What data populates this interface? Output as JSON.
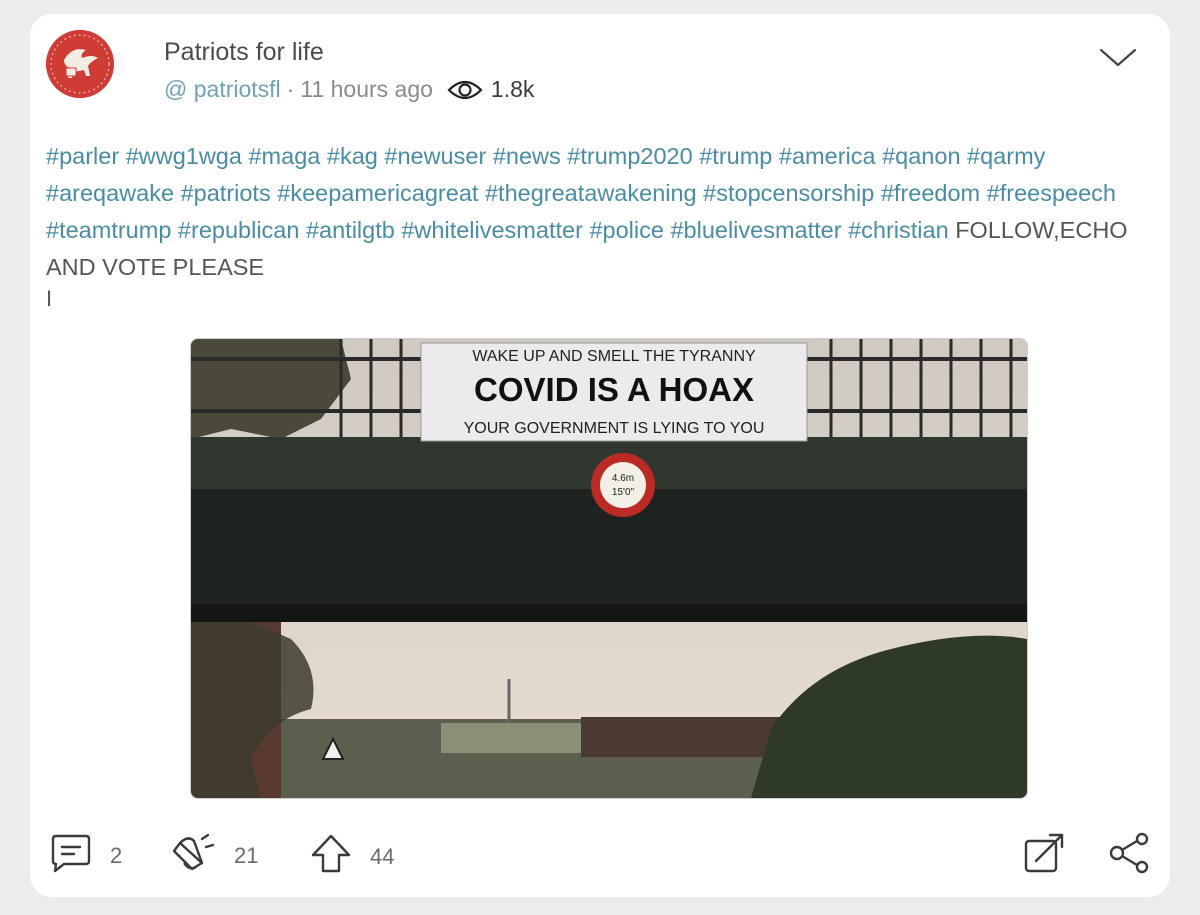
{
  "post": {
    "author": {
      "name": "Patriots for life",
      "handle": "@ patriotsfl",
      "time": "11 hours ago",
      "views": "1.8k",
      "avatar_icon": "winged-lion-icon"
    },
    "hashtags": [
      "#parler",
      "#wwg1wga",
      "#maga",
      "#kag",
      "#newuser",
      "#news",
      "#trump2020",
      "#trump",
      "#america",
      "#qanon",
      "#qarmy",
      "#areqawake",
      "#patriots",
      "#keepamericagreat",
      "#thegreatawakening",
      "#stopcensorship",
      "#freedom",
      "#freespeech",
      "#teamtrump",
      "#republican",
      "#antilgtb",
      "#whitelivesmatter",
      "#police",
      "#bluelivesmatter",
      "#christian"
    ],
    "body_text": "FOLLOW,ECHO AND VOTE PLEASE",
    "caret": "I",
    "image": {
      "banner_line1": "WAKE UP AND SMELL THE TYRANNY",
      "banner_line2": "COVID IS A HOAX",
      "banner_line3": "YOUR GOVERNMENT IS LYING TO YOU",
      "sign_line1": "4.6m",
      "sign_line2": "15'0\""
    },
    "actions": {
      "comments": "2",
      "echoes": "21",
      "upvotes": "44"
    }
  },
  "colors": {
    "hashtag": "#4a8ca3",
    "handle": "#6fa3b5",
    "avatar_bg": "#cf3b35",
    "card_bg": "#ffffff",
    "page_bg": "#ececec"
  }
}
